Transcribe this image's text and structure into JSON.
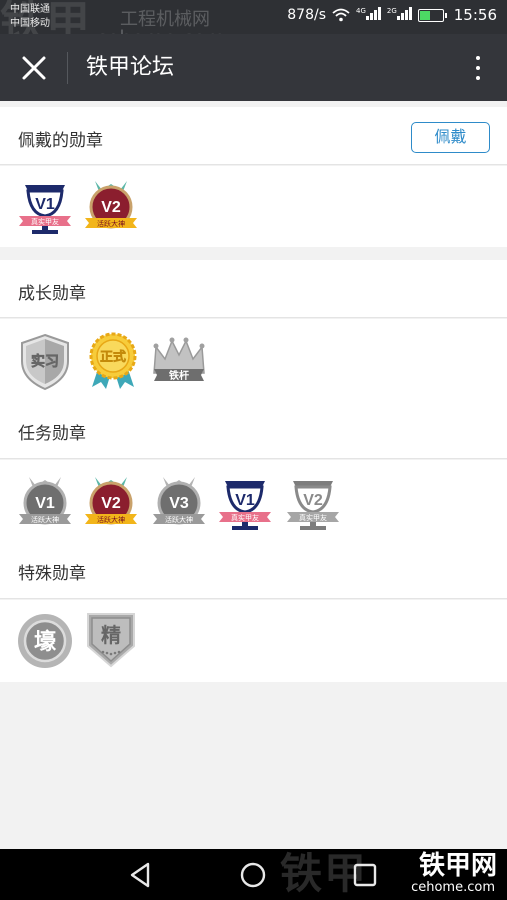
{
  "status_bar": {
    "carrier1": "中国联通",
    "carrier2": "中国移动",
    "speed": "878/s",
    "net_tag1": "4G",
    "net_tag2": "2G",
    "time": "15:56",
    "watermark_big": "铁甲",
    "watermark_site1": "工程机械网",
    "watermark_site2": "cehome.com"
  },
  "titlebar": {
    "title": "铁甲论坛",
    "close_icon": "close-icon",
    "more_icon": "more-vertical-icon"
  },
  "worn": {
    "label": "佩戴的勋章",
    "button_label": "佩戴",
    "badges": [
      {
        "name": "v1-trophy-badge",
        "text": "V1",
        "ribbon": "真实甲友"
      },
      {
        "name": "v2-medal-badge",
        "text": "V2",
        "ribbon": "活跃大神"
      }
    ]
  },
  "growth": {
    "label": "成长勋章",
    "badges": [
      {
        "name": "intern-shield-badge",
        "text": "实习"
      },
      {
        "name": "official-seal-badge",
        "text": "正式"
      },
      {
        "name": "iron-crown-badge",
        "text": "铁杆"
      }
    ]
  },
  "task": {
    "label": "任务勋章",
    "badges": [
      {
        "name": "v1-grey-medal-badge",
        "text": "V1",
        "ribbon": "活跃大神"
      },
      {
        "name": "v2-medal-badge",
        "text": "V2",
        "ribbon": "活跃大神"
      },
      {
        "name": "v3-grey-medal-badge",
        "text": "V3",
        "ribbon": "活跃大神"
      },
      {
        "name": "v1-trophy-badge",
        "text": "V1",
        "ribbon": "真实甲友"
      },
      {
        "name": "v2-grey-trophy-badge",
        "text": "V2",
        "ribbon": "真实甲友"
      }
    ]
  },
  "special": {
    "label": "特殊勋章",
    "badges": [
      {
        "name": "rich-coin-badge",
        "text": "壕"
      },
      {
        "name": "essence-shield-badge",
        "text": "精"
      }
    ]
  },
  "nav": {
    "back_icon": "back-triangle-icon",
    "home_icon": "home-circle-icon",
    "recent_icon": "recent-square-icon",
    "watermark_big": "铁甲",
    "watermark_logo": "铁甲网",
    "watermark_logo_site": "cehome.com"
  },
  "colors": {
    "accent": "#2e8bc9",
    "titlebar": "#34363b",
    "navy": "#1d2a6b",
    "maroon": "#8b1e2e",
    "gold": "#f2b51a",
    "pink_ribbon": "#e8708a",
    "grey": "#8f8f8f"
  }
}
